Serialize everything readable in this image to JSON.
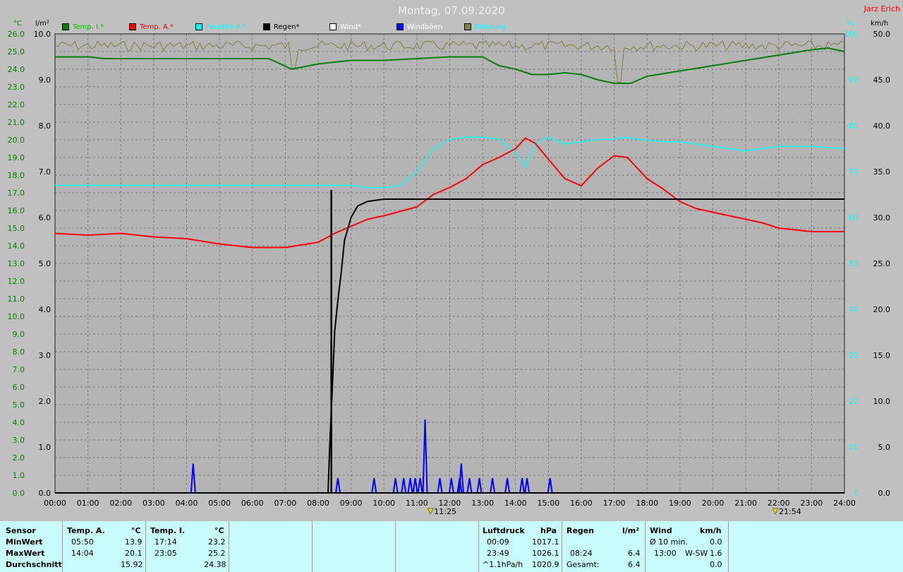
{
  "title": "Montag, 07.09.2020",
  "author": "Jarz Erich",
  "units": {
    "left1": "°C",
    "left2": "l/m²",
    "right1": "%",
    "right2": "km/h"
  },
  "legend": [
    {
      "label": "Temp. I.*",
      "color": "#008000",
      "text_color": "#00c000"
    },
    {
      "label": "Temp. A.*",
      "color": "#ff0000",
      "text_color": "#ff0000"
    },
    {
      "label": "Feuchte A.*",
      "color": "#00ffff",
      "text_color": "#00ffff"
    },
    {
      "label": "Regen*",
      "color": "#000000",
      "text_color": "#000000"
    },
    {
      "label": "Wind*",
      "color": "#ffffff",
      "text_color": "#ffffff"
    },
    {
      "label": "Windböen",
      "color": "#0000ff",
      "text_color": "#ffffff"
    },
    {
      "label": "Erholung",
      "color": "#808040",
      "text_color": "#00ffff"
    }
  ],
  "markers": [
    "11:25",
    "21:54"
  ],
  "chart_data": {
    "type": "line",
    "title": "Montag, 07.09.2020",
    "x_ticks": [
      "00:00",
      "01:00",
      "02:00",
      "03:00",
      "04:00",
      "05:00",
      "06:00",
      "07:00",
      "08:00",
      "09:00",
      "10:00",
      "11:00",
      "12:00",
      "13:00",
      "14:00",
      "15:00",
      "16:00",
      "17:00",
      "18:00",
      "19:00",
      "20:00",
      "21:00",
      "22:00",
      "23:00",
      "24:00"
    ],
    "xlim_hours": [
      0,
      24
    ],
    "axes": {
      "temp_c": {
        "ticks": [
          "0.0",
          "1.0",
          "2.0",
          "3.0",
          "4.0",
          "5.0",
          "6.0",
          "7.0",
          "8.0",
          "9.0",
          "10.0",
          "11.0",
          "12.0",
          "13.0",
          "14.0",
          "15.0",
          "16.0",
          "17.0",
          "18.0",
          "19.0",
          "20.0",
          "21.0",
          "22.0",
          "23.0",
          "24.0",
          "25.0",
          "26.0"
        ],
        "range": [
          0,
          26
        ],
        "color": "#008000"
      },
      "rain_lm2": {
        "ticks": [
          "0.0",
          "1.0",
          "2.0",
          "3.0",
          "4.0",
          "5.0",
          "6.0",
          "7.0",
          "8.0",
          "9.0",
          "10.0"
        ],
        "range": [
          0,
          10
        ],
        "color": "#000000"
      },
      "humidity_pct": {
        "ticks": [
          "0",
          "10",
          "20",
          "30",
          "40",
          "50",
          "60",
          "70",
          "80",
          "90",
          "100"
        ],
        "range": [
          0,
          100
        ],
        "color": "#00ffff"
      },
      "wind_kmh": {
        "ticks": [
          "0.0",
          "5.0",
          "10.0",
          "15.0",
          "20.0",
          "25.0",
          "30.0",
          "35.0",
          "40.0",
          "45.0",
          "50.0"
        ],
        "range": [
          0,
          50
        ],
        "color": "#000000"
      }
    },
    "series": [
      {
        "name": "Temp. I.*",
        "axis": "temp_c",
        "color": "#008000",
        "x": [
          0,
          1,
          1.5,
          3,
          5,
          6.5,
          7.2,
          8,
          9,
          10,
          11,
          12,
          13,
          13.5,
          14,
          14.5,
          15,
          15.5,
          16,
          16.5,
          17,
          17.5,
          18,
          19,
          20,
          21,
          22,
          23,
          23.5,
          24
        ],
        "y": [
          24.7,
          24.7,
          24.6,
          24.6,
          24.6,
          24.6,
          24.0,
          24.3,
          24.5,
          24.5,
          24.6,
          24.7,
          24.7,
          24.2,
          24.0,
          23.7,
          23.7,
          23.8,
          23.7,
          23.4,
          23.2,
          23.2,
          23.6,
          23.9,
          24.2,
          24.5,
          24.8,
          25.1,
          25.2,
          25.0
        ]
      },
      {
        "name": "Temp. A.*",
        "axis": "temp_c",
        "color": "#ff0000",
        "x": [
          0,
          1,
          2,
          3,
          4,
          5,
          6,
          7,
          8,
          8.5,
          9,
          9.5,
          10,
          11,
          11.5,
          12,
          12.5,
          13,
          13.5,
          14,
          14.3,
          14.6,
          15,
          15.5,
          16,
          16.5,
          17,
          17.4,
          17.8,
          18,
          18.5,
          19,
          19.5,
          20,
          20.5,
          21,
          21.5,
          22,
          22.5,
          23,
          23.5,
          24
        ],
        "y": [
          14.7,
          14.6,
          14.7,
          14.5,
          14.4,
          14.1,
          13.9,
          13.9,
          14.2,
          14.7,
          15.1,
          15.5,
          15.7,
          16.2,
          16.9,
          17.3,
          17.8,
          18.6,
          19.0,
          19.5,
          20.1,
          19.8,
          18.9,
          17.8,
          17.4,
          18.4,
          19.1,
          19.0,
          18.2,
          17.8,
          17.2,
          16.5,
          16.1,
          15.9,
          15.7,
          15.5,
          15.3,
          15.0,
          14.9,
          14.8,
          14.8,
          14.8
        ]
      },
      {
        "name": "Feuchte A.*",
        "axis": "humidity_pct",
        "color": "#00ffff",
        "x": [
          0,
          2,
          4,
          6,
          8,
          9,
          9.5,
          10,
          10.5,
          11,
          11.5,
          12,
          12.5,
          13,
          13.5,
          14,
          14.3,
          14.6,
          15,
          15.5,
          16,
          16.5,
          17,
          17.3,
          17.8,
          18.5,
          19,
          19.5,
          20,
          21,
          22,
          23,
          24
        ],
        "y": [
          67,
          67,
          67,
          67,
          67,
          67,
          66.5,
          66.5,
          67,
          70,
          75,
          77,
          77.5,
          77.5,
          77,
          74,
          71,
          76,
          77.5,
          76,
          76.5,
          77,
          77,
          77.5,
          77,
          76.5,
          76.5,
          76,
          75.5,
          74.5,
          75.5,
          75.5,
          75
        ]
      },
      {
        "name": "Regen*",
        "axis": "rain_lm2",
        "color": "#000000",
        "x": [
          0,
          8.3,
          8.35,
          8.45,
          8.5,
          8.6,
          8.7,
          8.8,
          9.0,
          9.2,
          9.5,
          10,
          12,
          24
        ],
        "y": [
          0,
          0,
          1.0,
          2.6,
          3.5,
          4.2,
          4.8,
          5.5,
          6.0,
          6.25,
          6.35,
          6.4,
          6.4,
          6.4
        ],
        "spike": {
          "x": 8.4,
          "y": 6.6
        }
      },
      {
        "name": "Windböen",
        "axis": "wind_kmh",
        "color": "#0000ff",
        "peaks": [
          [
            4.2,
            3.2
          ],
          [
            8.6,
            1.6
          ],
          [
            9.7,
            1.6
          ],
          [
            10.35,
            1.6
          ],
          [
            10.6,
            1.6
          ],
          [
            10.8,
            1.6
          ],
          [
            10.95,
            1.6
          ],
          [
            11.1,
            1.6
          ],
          [
            11.25,
            8.0
          ],
          [
            11.7,
            1.6
          ],
          [
            12.05,
            1.6
          ],
          [
            12.3,
            1.6
          ],
          [
            12.35,
            3.2
          ],
          [
            12.6,
            1.6
          ],
          [
            12.9,
            1.6
          ],
          [
            13.3,
            1.6
          ],
          [
            13.75,
            1.6
          ],
          [
            14.2,
            1.6
          ],
          [
            14.35,
            1.6
          ],
          [
            15.05,
            1.6
          ]
        ]
      },
      {
        "name": "Erholung",
        "axis": "humidity_pct",
        "color": "#808040",
        "baseline": 98.5,
        "dips": [
          [
            7.25,
            92.5
          ],
          [
            17.15,
            89.5
          ]
        ]
      }
    ]
  },
  "table": {
    "sensor": {
      "header": "Sensor",
      "rows": [
        "MinWert",
        "MaxWert",
        "Durchschnitt"
      ]
    },
    "temp_a": {
      "header": "Temp. A.",
      "unit": "°C",
      "min_time": "05:50",
      "min": "13.9",
      "max_time": "14:04",
      "max": "20.1",
      "avg": "15.92"
    },
    "temp_i": {
      "header": "Temp. I.",
      "unit": "°C",
      "min_time": "17:14",
      "min": "23.2",
      "max_time": "23:05",
      "max": "25.2",
      "avg": "24.38"
    },
    "pressure": {
      "header": "Luftdruck",
      "unit": "hPa",
      "min_time": "00:09",
      "min": "1017.1",
      "max_time": "23:49",
      "max": "1026.1",
      "trend": "^1.1hPa/h",
      "avg": "1020.9"
    },
    "rain": {
      "header": "Regen",
      "unit": "l/m²",
      "time": "08:24",
      "value": "6.4",
      "total_label": "Gesamt:",
      "total": "6.4"
    },
    "wind": {
      "header": "Wind",
      "unit": "km/h",
      "avg_label": "Ø 10 min.",
      "avg": "0.0",
      "max_time": "13:00",
      "max_dir": "W-SW",
      "max": "1.6",
      "mean": "0.0"
    }
  }
}
